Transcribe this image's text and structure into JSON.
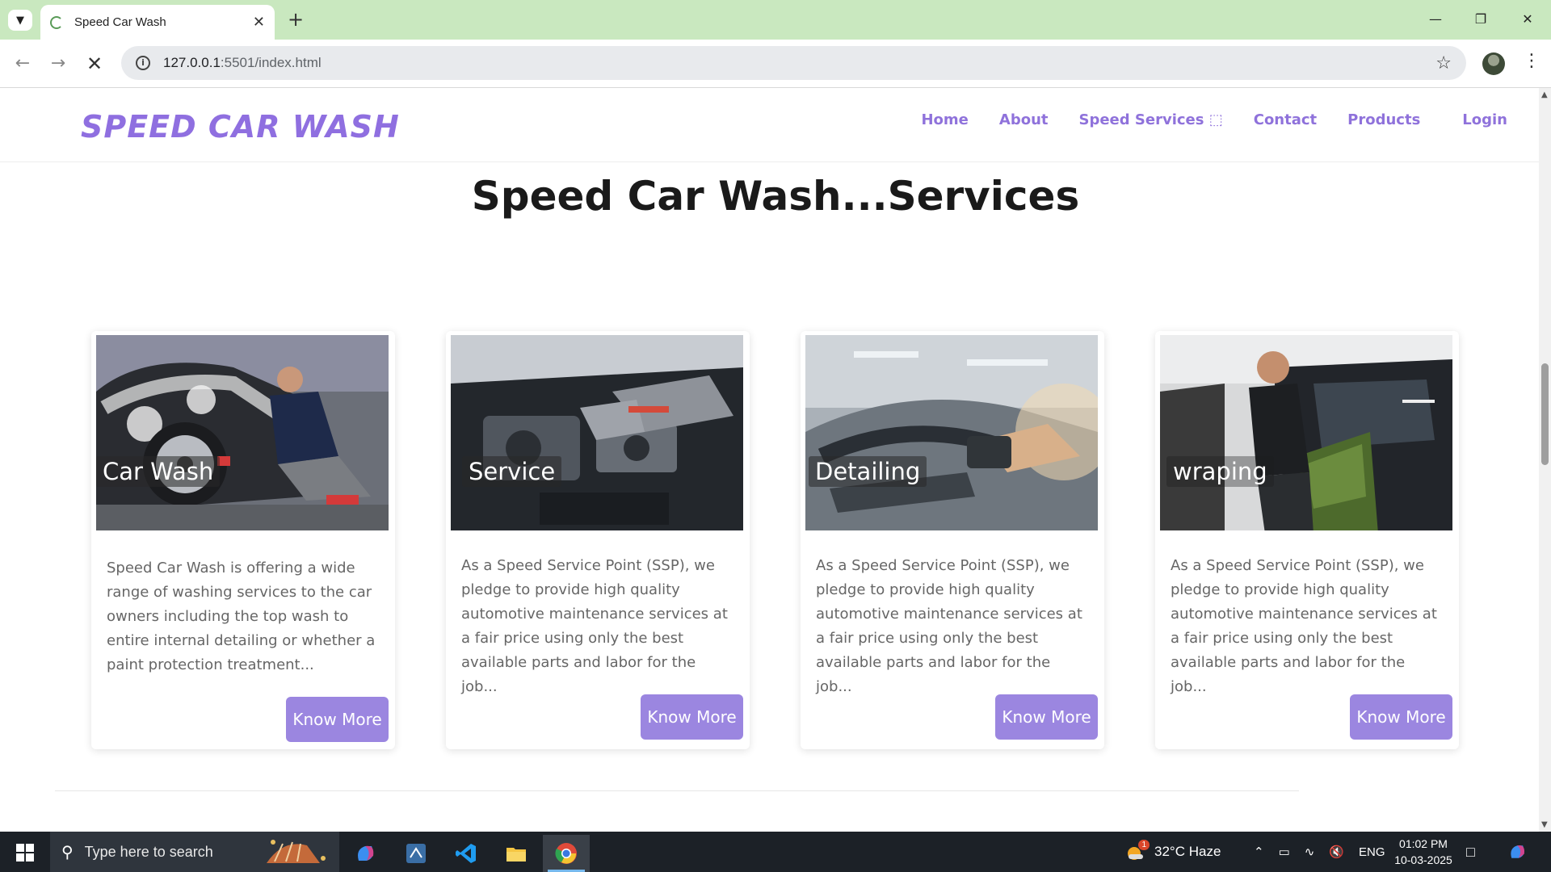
{
  "browser": {
    "tab_title": "Speed Car Wash",
    "url_host": "127.0.0.1",
    "url_rest": ":5501/index.html",
    "accent": "#c9e8bf"
  },
  "site": {
    "logo": "SPEED CAR WASH",
    "nav": {
      "home": "Home",
      "about": "About",
      "services": "Speed Services ⬚",
      "contact": "Contact",
      "products": "Products",
      "login": "Login"
    },
    "brand_color": "#8f6fe0",
    "section_title_bold": "Speed Car Wash...",
    "section_title_rest": "Services"
  },
  "cards": [
    {
      "caption": "Car Wash",
      "text": "Speed Car Wash is offering a wide range of washing services to the car owners including the top wash to entire internal detailing or whether a paint protection treatment...",
      "button": "Know More"
    },
    {
      "caption": "Service",
      "text": "As a Speed Service Point (SSP), we pledge to provide high quality automotive maintenance services at a fair price using only the best available parts and labor for the job...",
      "button": "Know More"
    },
    {
      "caption": "Detailing",
      "text": "As a Speed Service Point (SSP), we pledge to provide high quality automotive maintenance services at a fair price using only the best available parts and labor for the job...",
      "button": "Know More"
    },
    {
      "caption": "wraping",
      "text": "As a Speed Service Point (SSP), we pledge to provide high quality automotive maintenance services at a fair price using only the best available parts and labor for the job...",
      "button": "Know More"
    }
  ],
  "taskbar": {
    "search_placeholder": "Type here to search",
    "weather": "32°C  Haze",
    "weather_badge": "1",
    "language": "ENG",
    "time": "01:02 PM",
    "date": "10-03-2025"
  }
}
